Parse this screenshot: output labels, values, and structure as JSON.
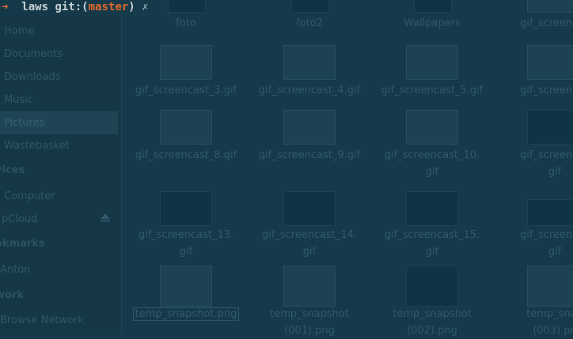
{
  "terminal": {
    "arrow": "➜",
    "dir": "laws",
    "git_prefix": "git:(",
    "branch": "master",
    "git_suffix": ")",
    "dirty_mark": "✗"
  },
  "sidebar": {
    "items": [
      {
        "label": "Home",
        "icon": "home-icon"
      },
      {
        "label": "Documents",
        "icon": "documents-icon"
      },
      {
        "label": "Downloads",
        "icon": "downloads-icon"
      },
      {
        "label": "Music",
        "icon": "music-icon"
      },
      {
        "label": "Pictures",
        "icon": "pictures-icon",
        "active": true
      },
      {
        "label": "Wastebasket",
        "icon": "trash-icon"
      }
    ],
    "devices_heading": "vices",
    "devices": [
      {
        "label": "Computer",
        "icon": "computer-icon"
      },
      {
        "label": "pCloud",
        "icon": "drive-icon"
      }
    ],
    "bookmarks_heading": "okmarks",
    "bookmarks": [
      {
        "label": "Anton",
        "icon": "folder-icon"
      }
    ],
    "network_heading": "work",
    "network": [
      {
        "label": "Browse Network",
        "icon": "network-icon"
      }
    ]
  },
  "files": {
    "row0": [
      "foto",
      "foto2",
      "Wallpapers",
      "gif_screencas"
    ],
    "row1": [
      "gif_screencast_3.gif",
      "gif_screencast_4.gif",
      "gif_screencast_5.gif",
      "gif_screencas"
    ],
    "row2": [
      [
        "gif_screencast_8.gif",
        ""
      ],
      [
        "gif_screencast_9.gif",
        ""
      ],
      [
        "gif_screencast_10.",
        "gif"
      ],
      [
        "gif_screencas",
        "gif"
      ]
    ],
    "row3": [
      [
        "gif_screencast_13.",
        "gif"
      ],
      [
        "gif_screencast_14.",
        "gif"
      ],
      [
        "gif_screencast_15.",
        "gif"
      ],
      [
        "gif_screencas",
        "gif"
      ]
    ],
    "row4": [
      [
        "temp_snapshot.png",
        ""
      ],
      [
        "temp_snapshot",
        "(001).png"
      ],
      [
        "temp_snapshot",
        "(002).png"
      ],
      [
        "temp_snap",
        "(003).pn"
      ]
    ]
  },
  "colors": {
    "accent": "#e06a2c",
    "background": "#163a49"
  }
}
